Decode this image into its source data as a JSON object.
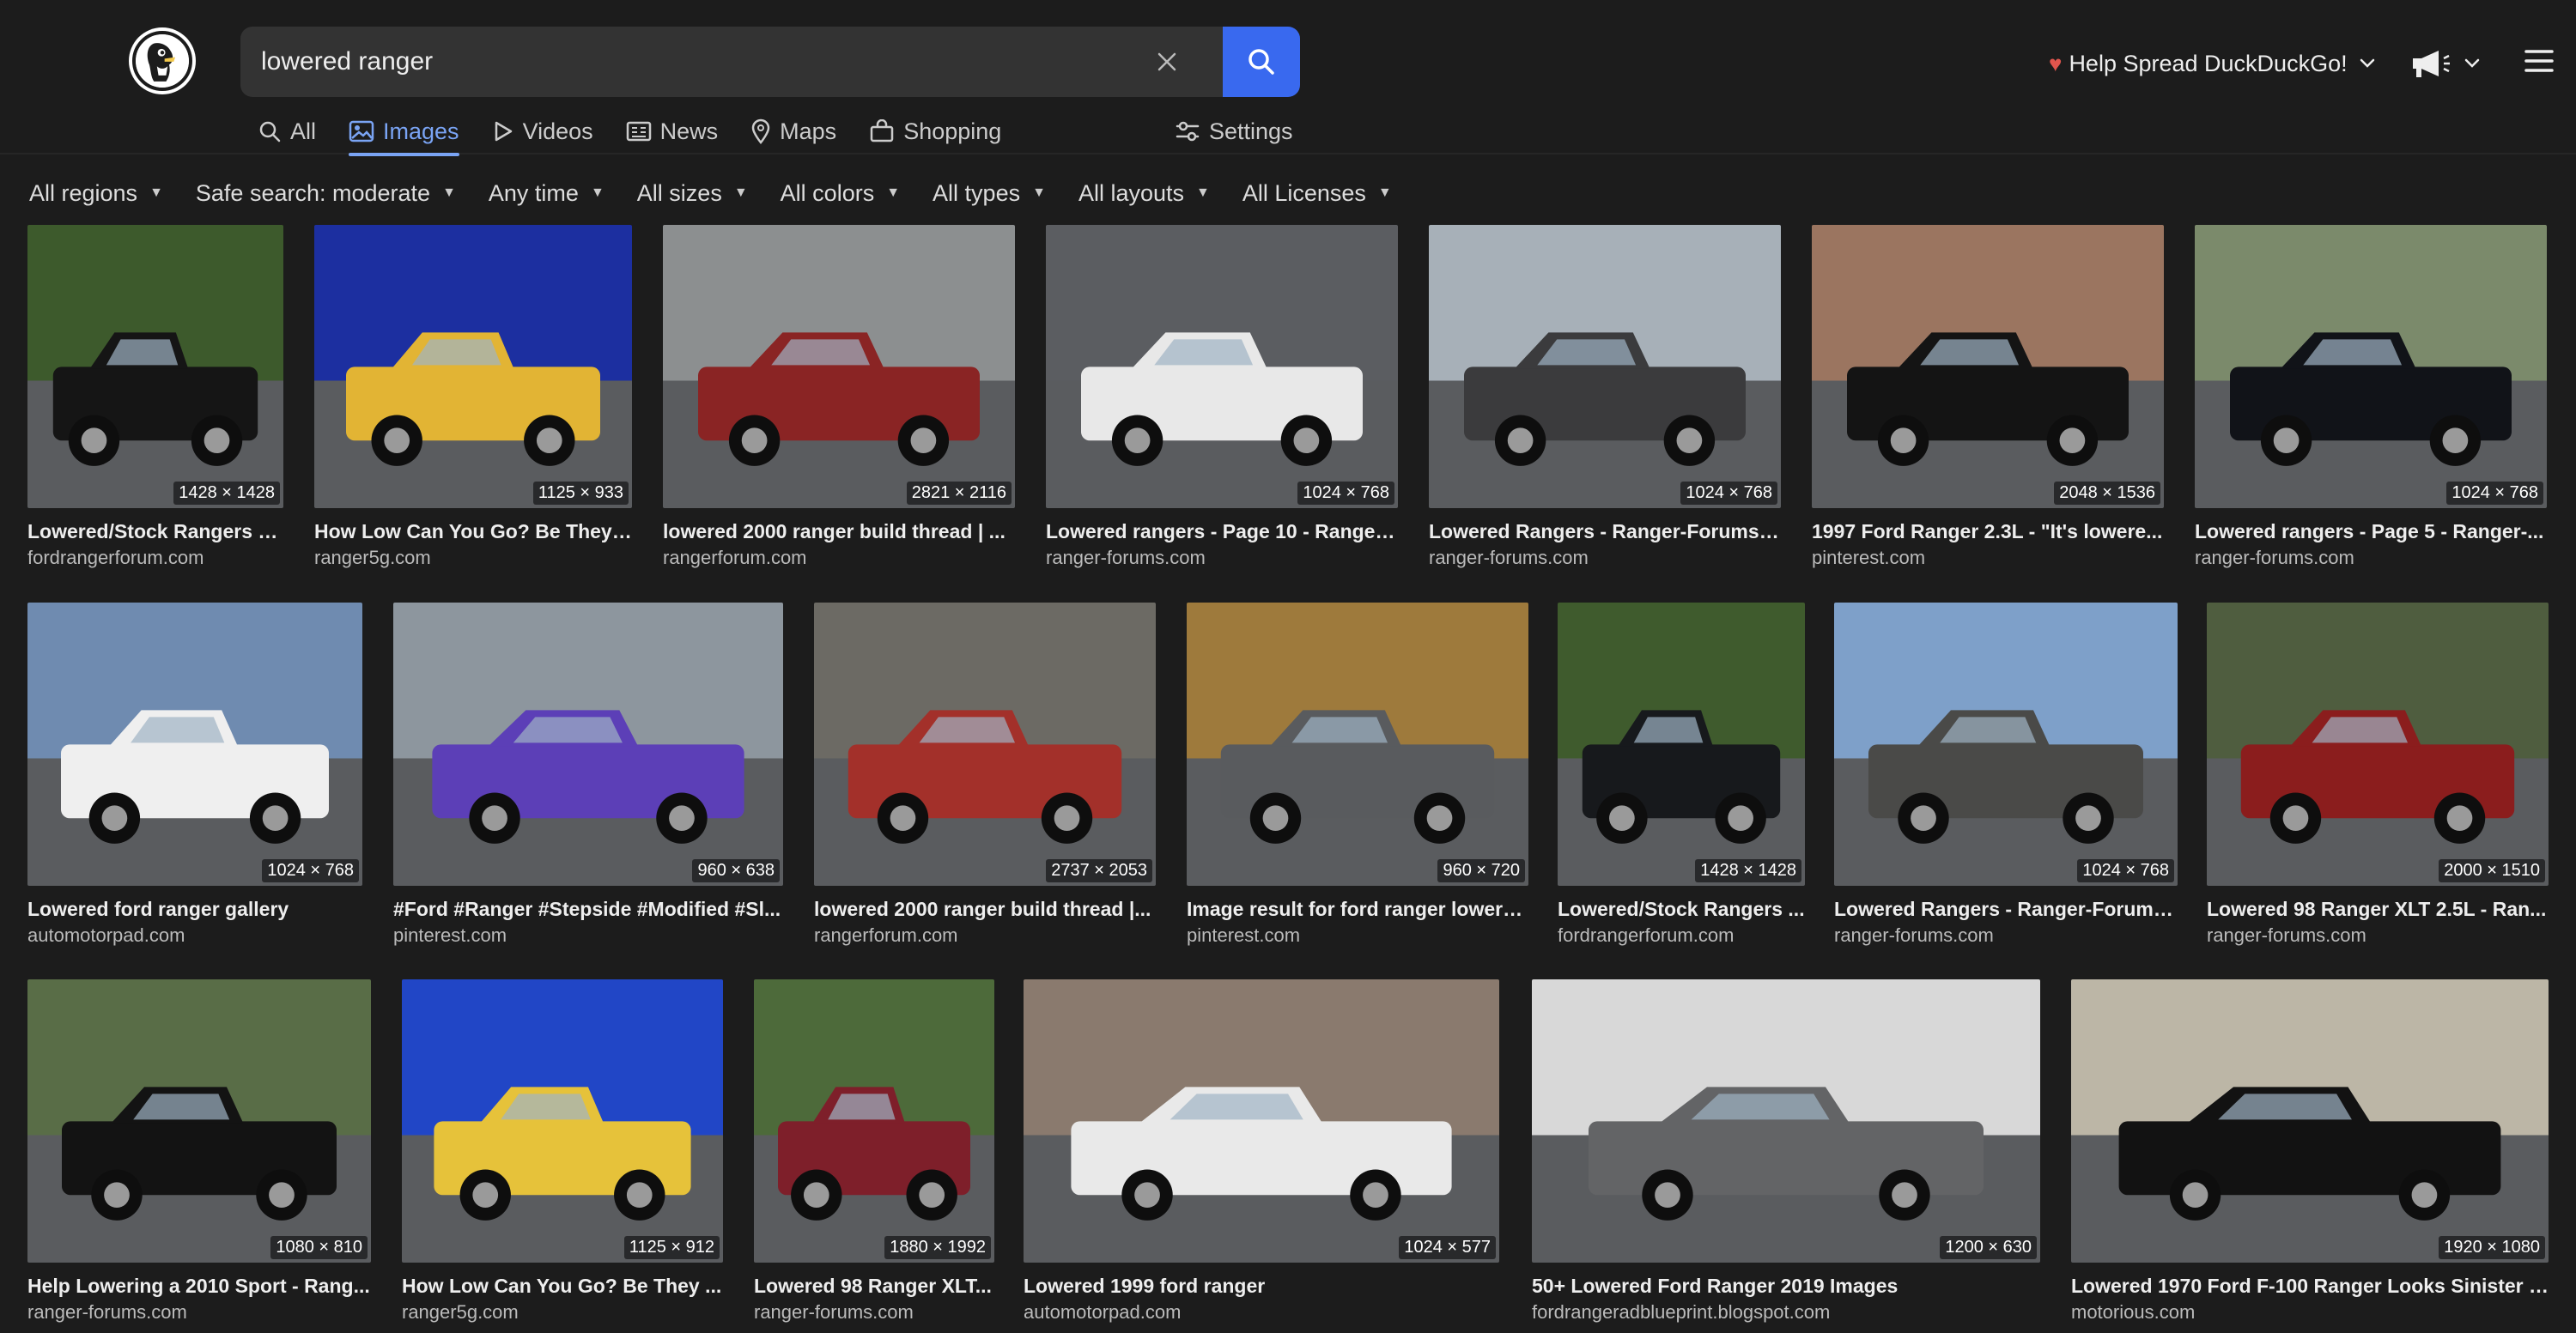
{
  "search": {
    "query": "lowered ranger"
  },
  "header": {
    "promo_label": "Help Spread DuckDuckGo!"
  },
  "tabs": [
    {
      "label": "All"
    },
    {
      "label": "Images"
    },
    {
      "label": "Videos"
    },
    {
      "label": "News"
    },
    {
      "label": "Maps"
    },
    {
      "label": "Shopping"
    }
  ],
  "settings_label": "Settings",
  "filters": [
    {
      "label": "All regions"
    },
    {
      "label": "Safe search: moderate"
    },
    {
      "label": "Any time"
    },
    {
      "label": "All sizes"
    },
    {
      "label": "All colors"
    },
    {
      "label": "All types"
    },
    {
      "label": "All layouts"
    },
    {
      "label": "All Licenses"
    }
  ],
  "colors": {
    "accent": "#3969ef",
    "active_tab": "#7aa4f4",
    "background": "#1c1c1c"
  },
  "results": [
    {
      "title": "Lowered/Stock Rangers o...",
      "domain": "fordrangerforum.com",
      "dims": "1428 × 1428",
      "truck": "#151515",
      "bg": "#3d5a2c"
    },
    {
      "title": "How Low Can You Go? Be They ...",
      "domain": "ranger5g.com",
      "dims": "1125 × 933",
      "truck": "#e2b434",
      "bg": "#1c2fa0"
    },
    {
      "title": "lowered 2000 ranger build thread | ...",
      "domain": "rangerforum.com",
      "dims": "2821 × 2116",
      "truck": "#8a2424",
      "bg": "#8c8f90"
    },
    {
      "title": "Lowered rangers - Page 10 - Ranger-...",
      "domain": "ranger-forums.com",
      "dims": "1024 × 768",
      "truck": "#e8e8e8",
      "bg": "#5b5d61"
    },
    {
      "title": "Lowered Rangers - Ranger-Forums -...",
      "domain": "ranger-forums.com",
      "dims": "1024 × 768",
      "truck": "#3b3b3d",
      "bg": "#a7b0b8"
    },
    {
      "title": "1997 Ford Ranger 2.3L - \"It's lowere...",
      "domain": "pinterest.com",
      "dims": "2048 × 1536",
      "truck": "#141414",
      "bg": "#9b7560"
    },
    {
      "title": "Lowered rangers - Page 5 - Ranger-...",
      "domain": "ranger-forums.com",
      "dims": "1024 × 768",
      "truck": "#111318",
      "bg": "#7b8a6b"
    },
    {
      "title": "Lowered ford ranger gallery",
      "domain": "automotorpad.com",
      "dims": "1024 × 768",
      "truck": "#efefef",
      "bg": "#6f8bb0"
    },
    {
      "title": "#Ford #Ranger #Stepside #Modified #Sl...",
      "domain": "pinterest.com",
      "dims": "960 × 638",
      "truck": "#5c3fb7",
      "bg": "#8d969e"
    },
    {
      "title": "lowered 2000 ranger build thread |...",
      "domain": "rangerforum.com",
      "dims": "2737 × 2053",
      "truck": "#a3302a",
      "bg": "#6c6a64"
    },
    {
      "title": "Image result for ford ranger lowere...",
      "domain": "pinterest.com",
      "dims": "960 × 720",
      "truck": "#595b5e",
      "bg": "#9e7a3c"
    },
    {
      "title": "Lowered/Stock Rangers ...",
      "domain": "fordrangerforum.com",
      "dims": "1428 × 1428",
      "truck": "#17191c",
      "bg": "#3f5b2d"
    },
    {
      "title": "Lowered Rangers - Ranger-Forums...",
      "domain": "ranger-forums.com",
      "dims": "1024 × 768",
      "truck": "#4a4a48",
      "bg": "#7ea0c9"
    },
    {
      "title": "Lowered 98 Ranger XLT 2.5L - Ran...",
      "domain": "ranger-forums.com",
      "dims": "2000 × 1510",
      "truck": "#8b1d1d",
      "bg": "#4f5d3f"
    },
    {
      "title": "Help Lowering a 2010 Sport - Rang...",
      "domain": "ranger-forums.com",
      "dims": "1080 × 810",
      "truck": "#131313",
      "bg": "#596d47"
    },
    {
      "title": "How Low Can You Go? Be They ...",
      "domain": "ranger5g.com",
      "dims": "1125 × 912",
      "truck": "#e6c23a",
      "bg": "#2146c6"
    },
    {
      "title": "Lowered 98 Ranger XLT...",
      "domain": "ranger-forums.com",
      "dims": "1880 × 1992",
      "truck": "#7e1f2a",
      "bg": "#4d6a3a"
    },
    {
      "title": "Lowered 1999 ford ranger",
      "domain": "automotorpad.com",
      "dims": "1024 × 577",
      "truck": "#e9e9e9",
      "bg": "#8a7a6e"
    },
    {
      "title": "50+ Lowered Ford Ranger 2019 Images",
      "domain": "fordrangeradblueprint.blogspot.com",
      "dims": "1200 × 630",
      "truck": "#636466",
      "bg": "#d8d8d8"
    },
    {
      "title": "Lowered 1970 Ford F-100 Ranger Looks Sinister | ...",
      "domain": "motorious.com",
      "dims": "1920 × 1080",
      "truck": "#121212",
      "bg": "#bcb6a6"
    }
  ]
}
